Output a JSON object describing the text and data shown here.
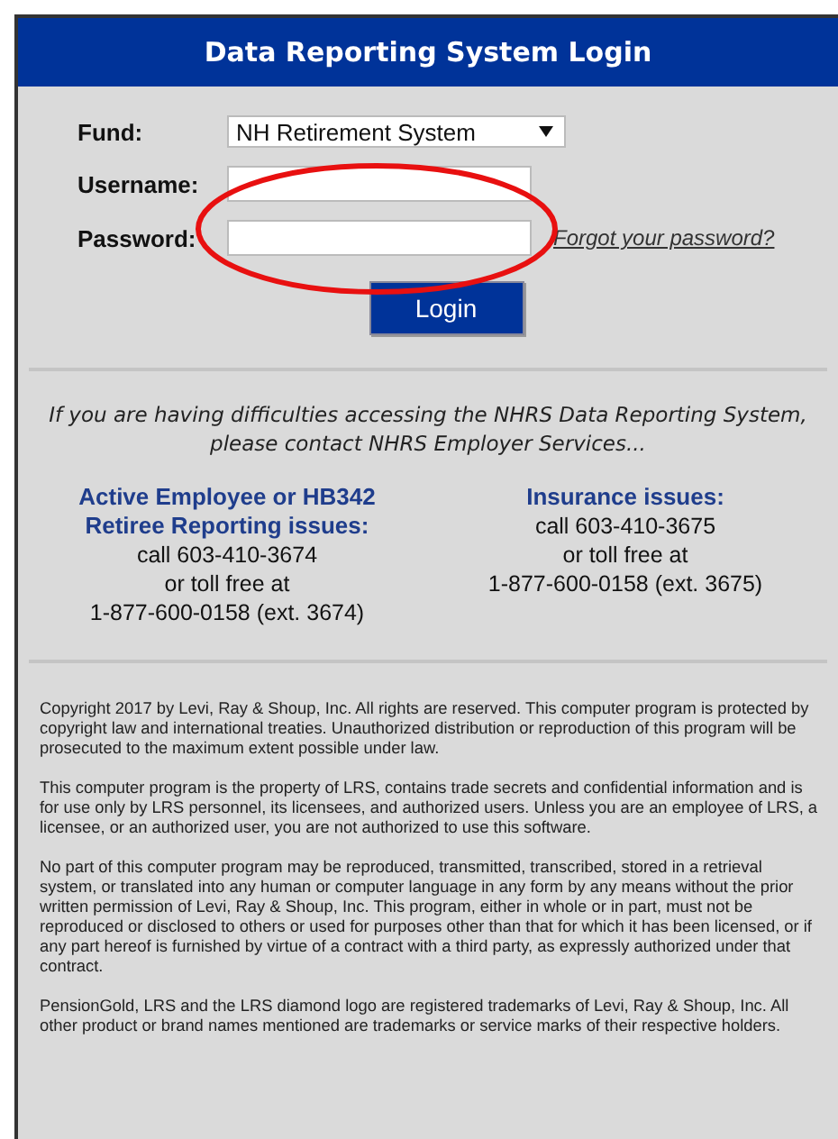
{
  "header": {
    "title": "Data Reporting System Login"
  },
  "form": {
    "fields": [
      {
        "kind": "select",
        "label": "Fund:",
        "value": "NH Retirement System"
      },
      {
        "kind": "text",
        "label": "Username:"
      },
      {
        "kind": "password",
        "label": "Password:",
        "link": "Forgot your password?"
      }
    ],
    "button": "Login"
  },
  "help": {
    "message": [
      "If you are having difficulties accessing the NHRS Data Reporting System,",
      "please contact NHRS Employer Services..."
    ],
    "contacts": [
      {
        "heading": [
          "Active Employee or HB342",
          "Retiree Reporting issues:"
        ],
        "lines": [
          "call 603-410-3674",
          "or toll free at",
          "1-877-600-0158 (ext. 3674)"
        ]
      },
      {
        "heading": [
          "Insurance issues:"
        ],
        "lines": [
          "call 603-410-3675",
          "or toll free at",
          "1-877-600-0158 (ext. 3675)"
        ]
      }
    ]
  },
  "legal": [
    "Copyright 2017 by Levi, Ray & Shoup, Inc. All rights are reserved. This computer program is protected by copyright law and international treaties. Unauthorized distribution or reproduction of this program will be prosecuted to the maximum extent possible under law.",
    "This computer program is the property of LRS, contains trade secrets and confidential information and is for use only by LRS personnel, its licensees, and authorized users. Unless you are an employee of LRS, a licensee, or an authorized user, you are not authorized to use this software.",
    "No part of this computer program may be reproduced, transmitted, transcribed, stored in a retrieval system, or translated into any human or computer language in any form by any means without the prior written permission of Levi, Ray & Shoup, Inc. This program, either in whole or in part, must not be reproduced or disclosed to others or used for purposes other than that for which it has been licensed, or if any part hereof is furnished by virtue of a contract with a third party, as expressly authorized under that contract.",
    "PensionGold, LRS and the LRS diamond logo are registered trademarks of Levi, Ray & Shoup, Inc. All other product or brand names mentioned are trademarks or service marks of their respective holders."
  ],
  "annotation": {
    "kind": "ellipse"
  }
}
